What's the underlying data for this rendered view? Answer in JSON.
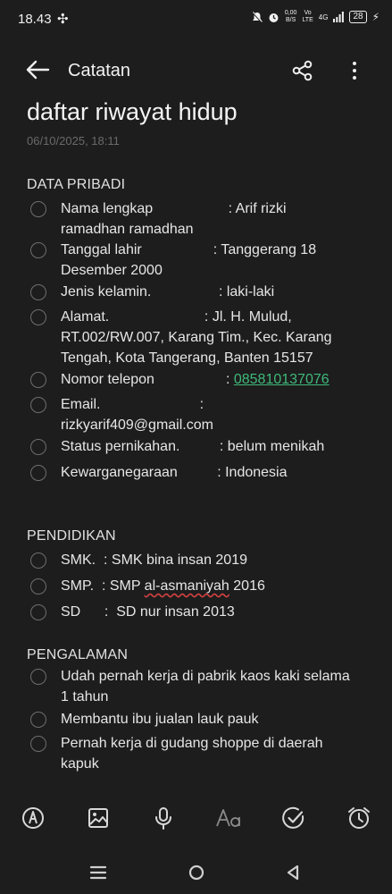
{
  "status_bar": {
    "time": "18.43",
    "net_speed_top": "0,00",
    "net_speed_bottom": "B/S",
    "network_label_top": "Vo",
    "network_label_bottom": "LTE",
    "network_type": "4G",
    "battery": "28"
  },
  "app_bar": {
    "title": "Catatan"
  },
  "note": {
    "title": "daftar riwayat hidup",
    "date": "06/10/2025, 18:11"
  },
  "sections": {
    "personal": {
      "header": "DATA PRIBADI",
      "items": [
        {
          "l1": "Nama lengkap                   : Arif rizki",
          "l2": "ramadhan ramadhan"
        },
        {
          "l1": "Tanggal lahir                  : Tanggerang 18",
          "l2": "Desember 2000"
        },
        {
          "l1": "Jenis kelamin.                 : laki-laki"
        },
        {
          "l1": "Alamat.                        : Jl. H. Mulud,",
          "l2": "RT.002/RW.007, Karang Tim., Kec. Karang",
          "l3": "Tengah, Kota Tangerang, Banten 15157"
        },
        {
          "l1_prefix": "Nomor telepon                  : ",
          "phone": "085810137076"
        },
        {
          "l1": "Email.                         :",
          "l2": "rizkyarif409@gmail.com"
        },
        {
          "l1": "Status pernikahan.          : belum menikah"
        },
        {
          "l1": "Kewarganegaraan          : Indonesia"
        }
      ]
    },
    "education": {
      "header": "PENDIDIKAN",
      "items": [
        {
          "l1": "SMK.  : SMK bina insan 2019"
        },
        {
          "pre": "SMP.  : SMP ",
          "sq": "al-asmaniyah",
          "post": " 2016"
        },
        {
          "l1": "SD      :  SD nur insan 2013"
        }
      ]
    },
    "experience": {
      "header": "PENGALAMAN",
      "items": [
        {
          "l1": "Udah pernah kerja di pabrik kaos kaki selama",
          "l2": "1 tahun"
        },
        {
          "l1": "Membantu ibu jualan lauk pauk"
        },
        {
          "l1": "Pernah kerja di gudang shoppe di daerah",
          "l2": "kapuk"
        }
      ]
    }
  },
  "toolbar_icons": [
    "pen-icon",
    "image-icon",
    "microphone-icon",
    "text-format-icon",
    "checklist-icon",
    "alarm-icon"
  ],
  "colors": {
    "background": "#1d1d1d",
    "link": "#3fb97a",
    "text": "#e6e6e6",
    "checkbox": "#6e6e6e"
  }
}
